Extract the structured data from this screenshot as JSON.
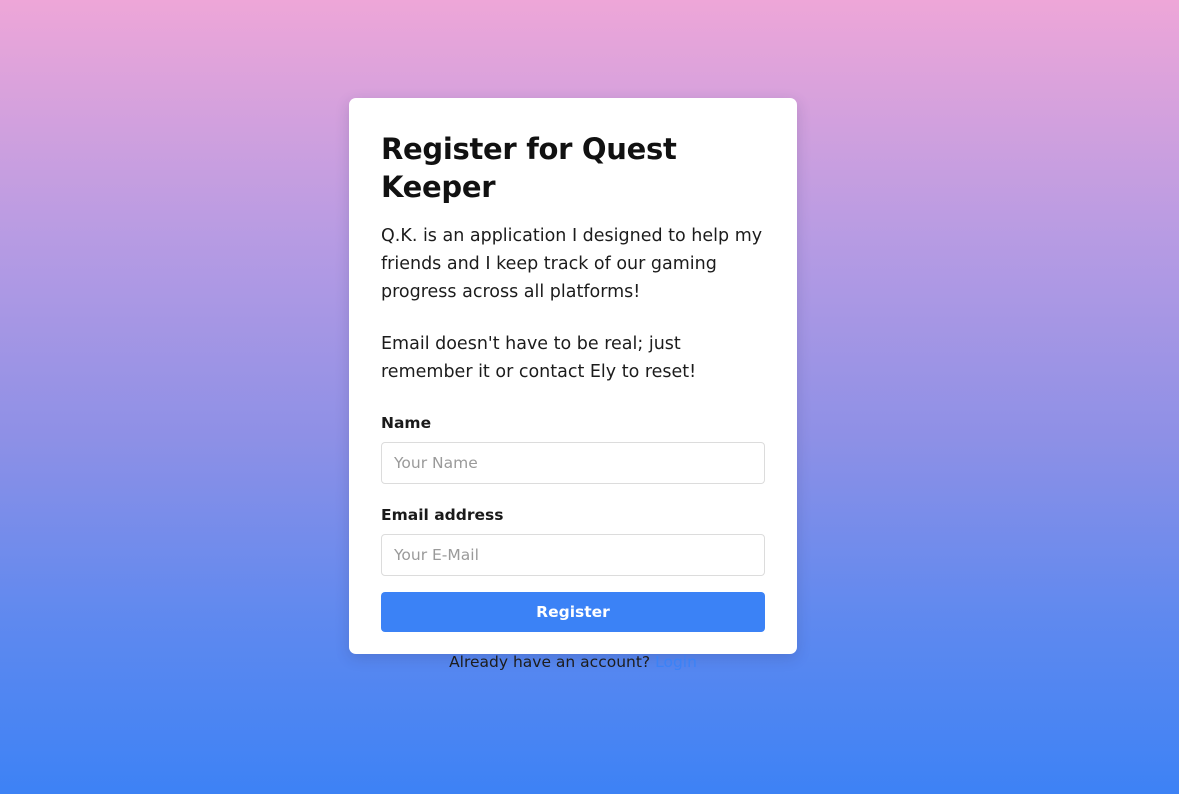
{
  "form": {
    "title": "Register for Quest Keeper",
    "description": "Q.K. is an application I designed to help my friends and I keep track of our gaming progress across all platforms!",
    "note": "Email doesn't have to be real; just remember it or contact Ely to reset!",
    "name_label": "Name",
    "name_placeholder": "Your Name",
    "name_value": "",
    "email_label": "Email address",
    "email_placeholder": "Your E-Mail",
    "email_value": "",
    "register_label": "Register",
    "footer_text": "Already have an account?",
    "login_label": "Login"
  },
  "colors": {
    "accent": "#3b82f6",
    "gradient_top": "#eea6d8",
    "gradient_bottom": "#3d82f5"
  }
}
